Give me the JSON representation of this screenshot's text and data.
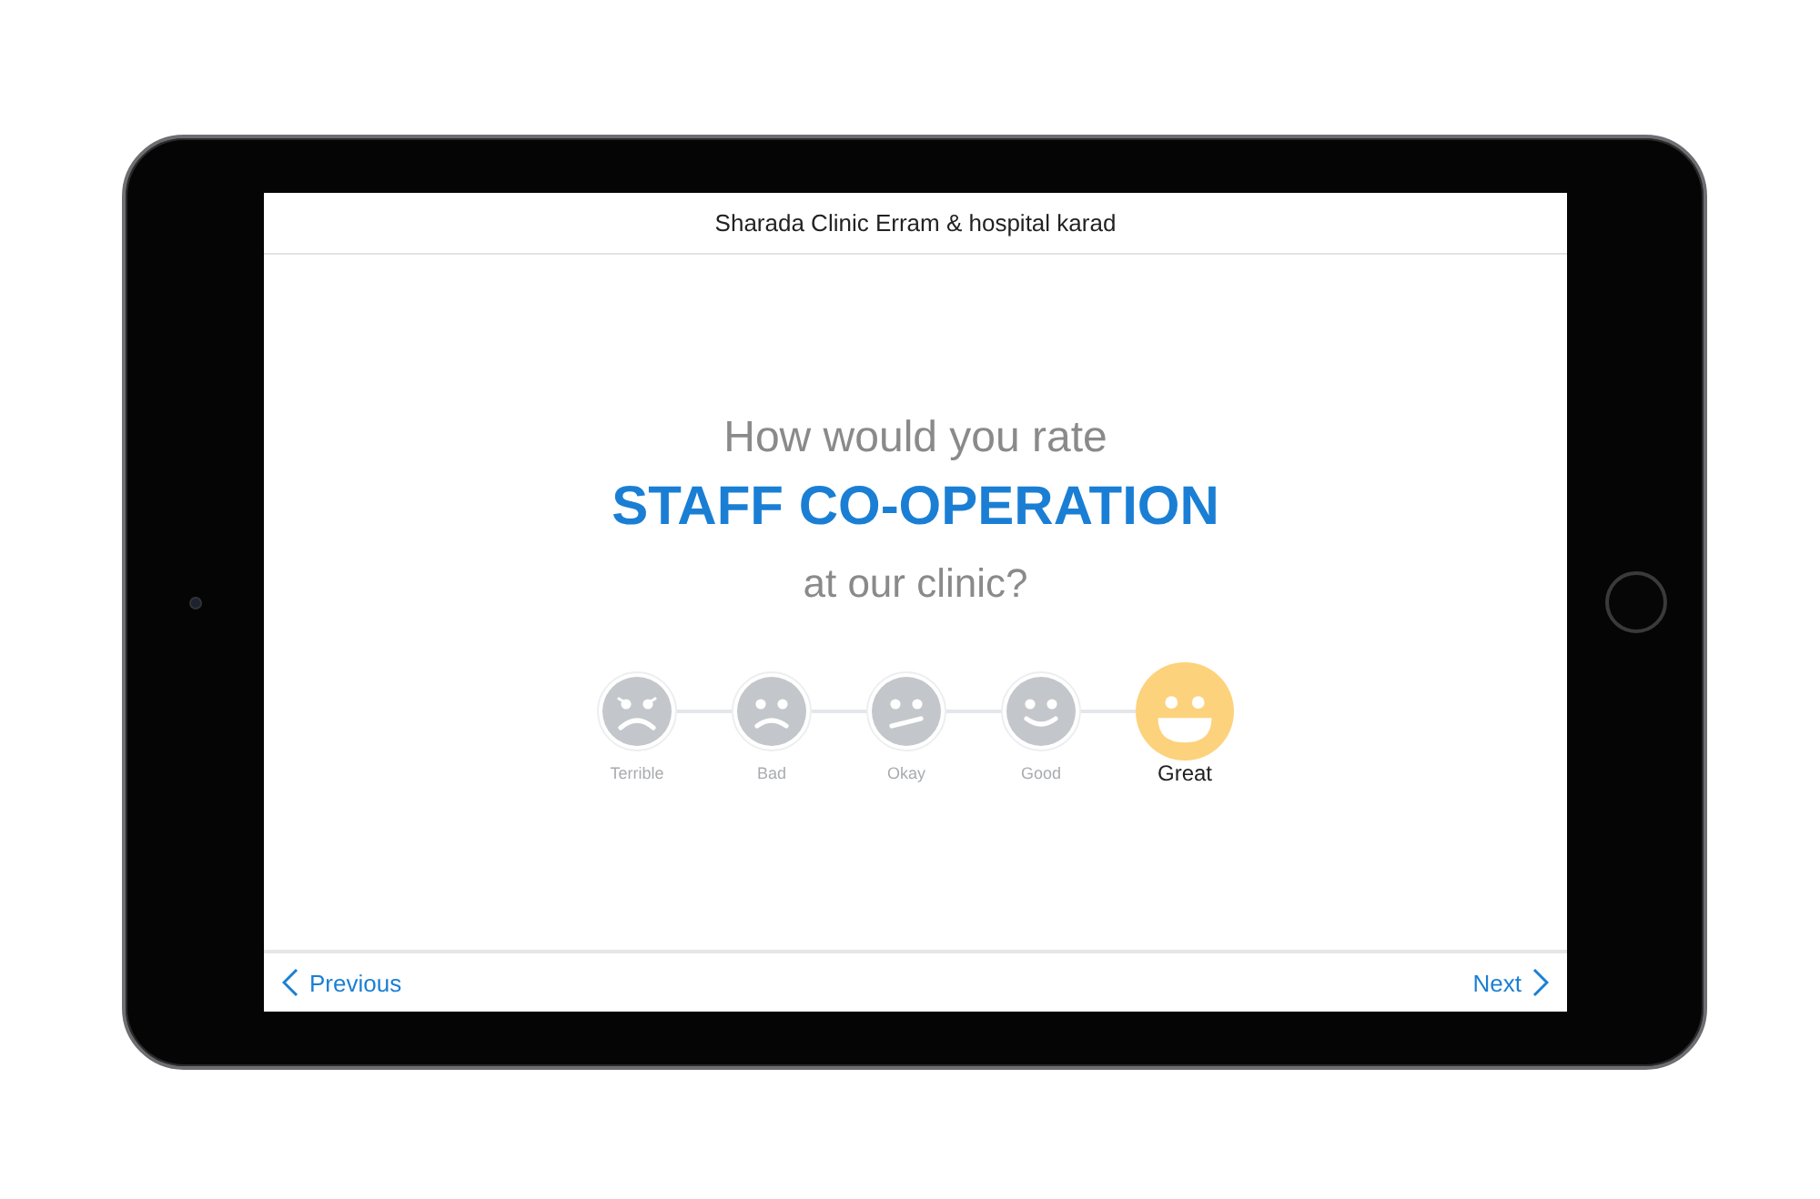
{
  "header": {
    "title": "Sharada Clinic Erram & hospital karad"
  },
  "question": {
    "intro": "How would you rate",
    "topic": "STAFF CO-OPERATION",
    "outro": "at our clinic?"
  },
  "ratings": [
    {
      "kind": "terrible",
      "label": "Terrible",
      "selected": false
    },
    {
      "kind": "bad",
      "label": "Bad",
      "selected": false
    },
    {
      "kind": "okay",
      "label": "Okay",
      "selected": false
    },
    {
      "kind": "good",
      "label": "Good",
      "selected": false
    },
    {
      "kind": "great",
      "label": "Great",
      "selected": true
    }
  ],
  "footer": {
    "previous": "Previous",
    "next": "Next"
  }
}
